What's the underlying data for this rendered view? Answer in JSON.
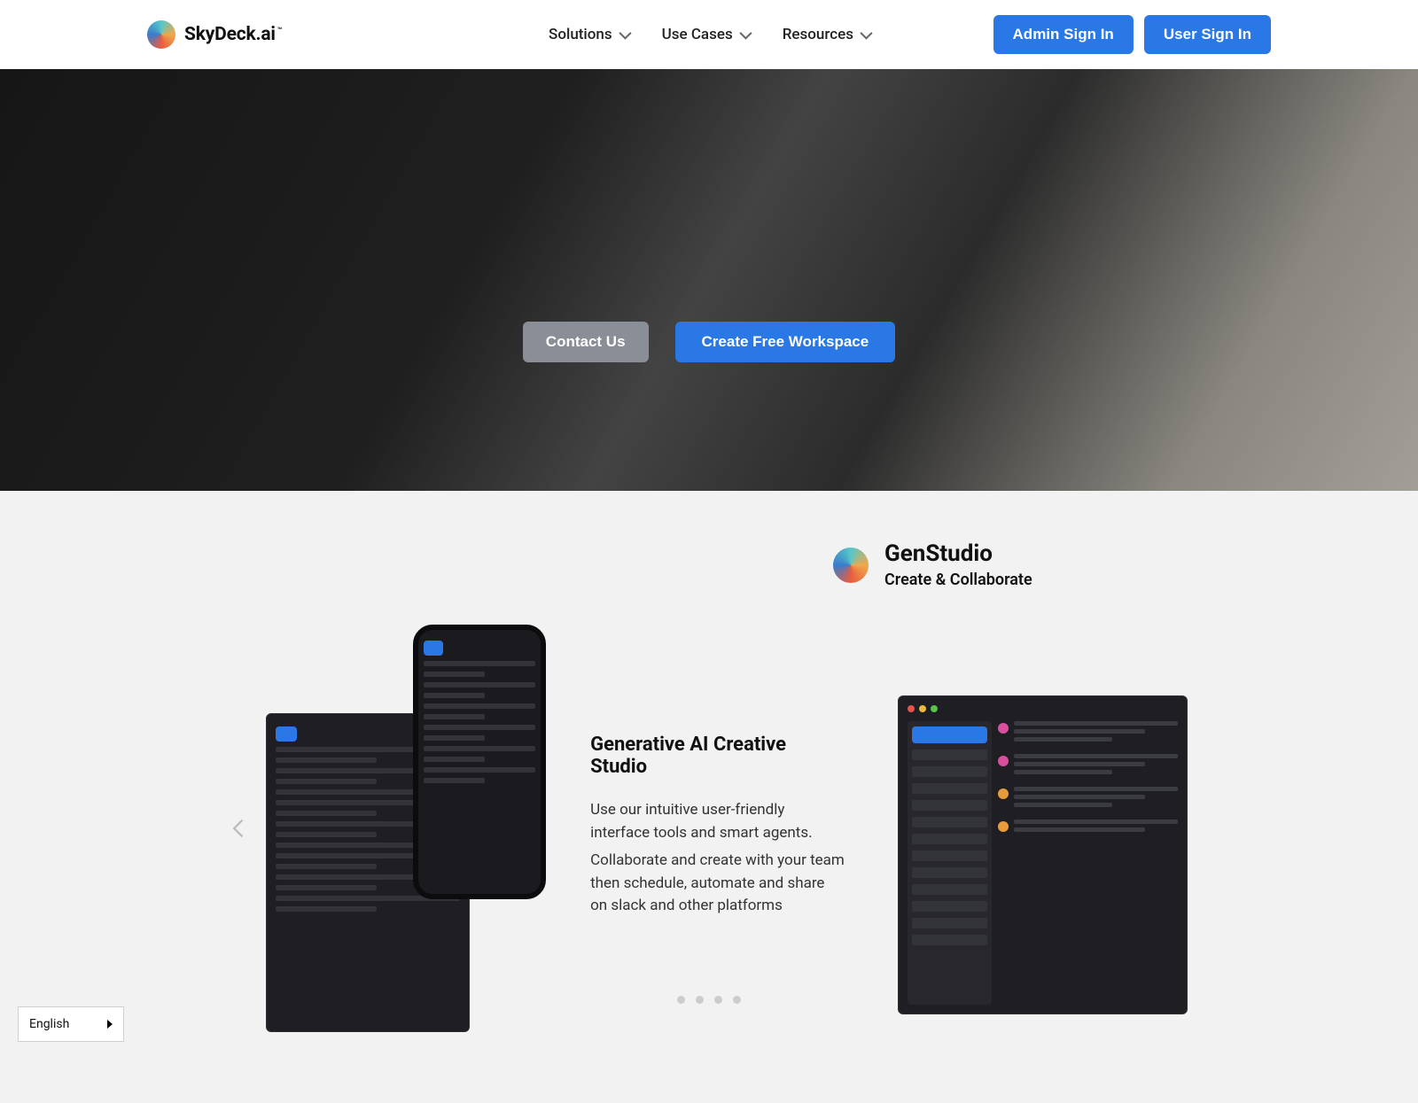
{
  "logo_text": "SkyDeck.ai",
  "logo_tm": "™",
  "nav": {
    "items": [
      "Solutions",
      "Use Cases",
      "Resources"
    ],
    "admin_signin": "Admin Sign In",
    "user_signin": "User Sign In"
  },
  "hero": {
    "contact_btn": "Contact Us",
    "create_btn": "Create Free Workspace"
  },
  "feature": {
    "title": "GenStudio",
    "subtitle": "Create & Collaborate",
    "slide_heading": "Generative AI Creative Studio",
    "slide_para1": "Use our intuitive user-friendly interface tools and smart agents.",
    "slide_para2": "Collaborate and create with your team then schedule, automate and share on slack and other platforms"
  },
  "lang": {
    "label": "English"
  }
}
